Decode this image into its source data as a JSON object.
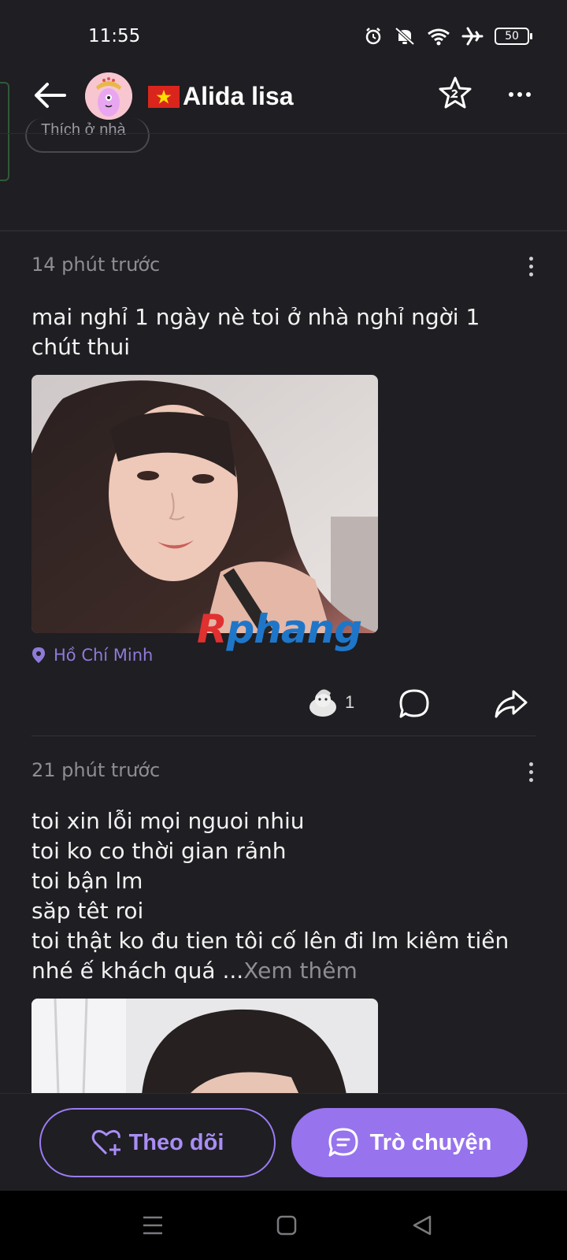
{
  "status_bar": {
    "time": "11:55",
    "battery": "50",
    "icons": [
      "alarm-icon",
      "mute-icon",
      "wifi-icon",
      "airplane-icon",
      "battery-icon"
    ]
  },
  "header": {
    "name": "Alida lisa",
    "flag": "vietnam-flag-icon"
  },
  "profile_tag": "Thích ở nhà",
  "posts": [
    {
      "time": "14 phút trước",
      "text": "mai nghỉ 1 ngày nè toi ở nhà nghỉ ngời 1 chút thui",
      "location": "Hồ Chí Minh",
      "reaction_count": "1"
    },
    {
      "time": "21 phút trước",
      "text": "toi xin lỗi mọi nguoi nhiu\ntoi ko co thời gian rảnh\ntoi bận lm\nsăp têt roi\ntoi thật ko đu tien tôi cố lên đi lm kiêm tiền\nnhé ế khách quá ...",
      "see_more": "Xem thêm"
    }
  ],
  "watermark": {
    "part1": "R",
    "part2": "phang"
  },
  "bottom_bar": {
    "follow_label": "Theo dõi",
    "chat_label": "Trò chuyện"
  },
  "colors": {
    "background": "#1f1e22",
    "accent": "#9773ee",
    "location": "#8f7bd8"
  }
}
